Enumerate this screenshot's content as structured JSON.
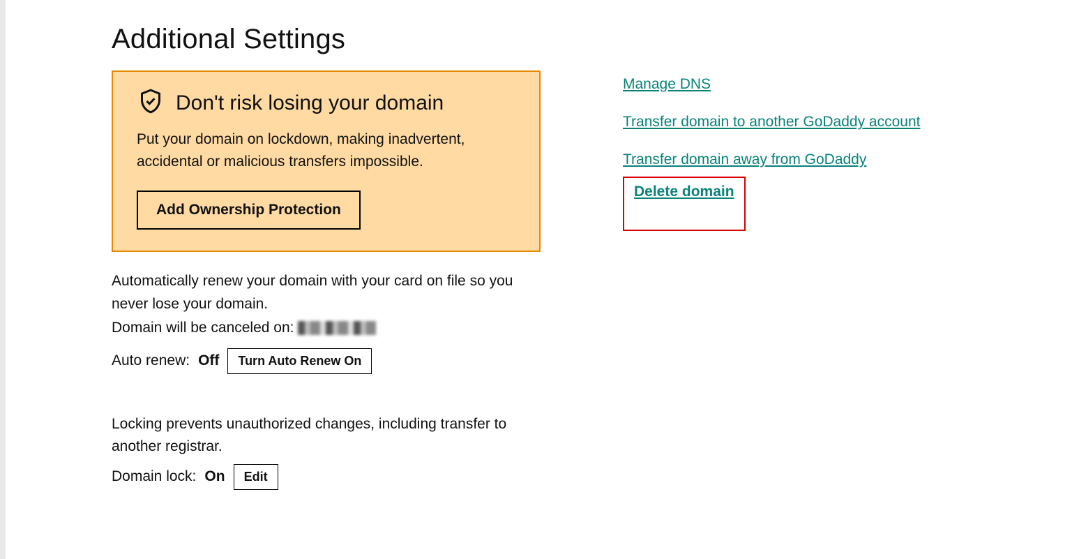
{
  "page": {
    "title": "Additional Settings"
  },
  "promo": {
    "title": "Don't risk losing your domain",
    "description": "Put your domain on lockdown, making inadvertent, accidental or malicious transfers impossible.",
    "button": "Add Ownership Protection"
  },
  "autorenew": {
    "description": "Automatically renew your domain with your card on file so you never lose your domain.",
    "cancel_label": "Domain will be canceled on:",
    "label": "Auto renew:",
    "value": "Off",
    "button": "Turn Auto Renew On"
  },
  "lock": {
    "description": "Locking prevents unauthorized changes, including transfer to another registrar.",
    "label": "Domain lock:",
    "value": "On",
    "button": "Edit"
  },
  "links": {
    "manage_dns": "Manage DNS",
    "transfer_account": "Transfer domain to another GoDaddy account",
    "transfer_away": "Transfer domain away from GoDaddy",
    "delete": "Delete domain"
  }
}
